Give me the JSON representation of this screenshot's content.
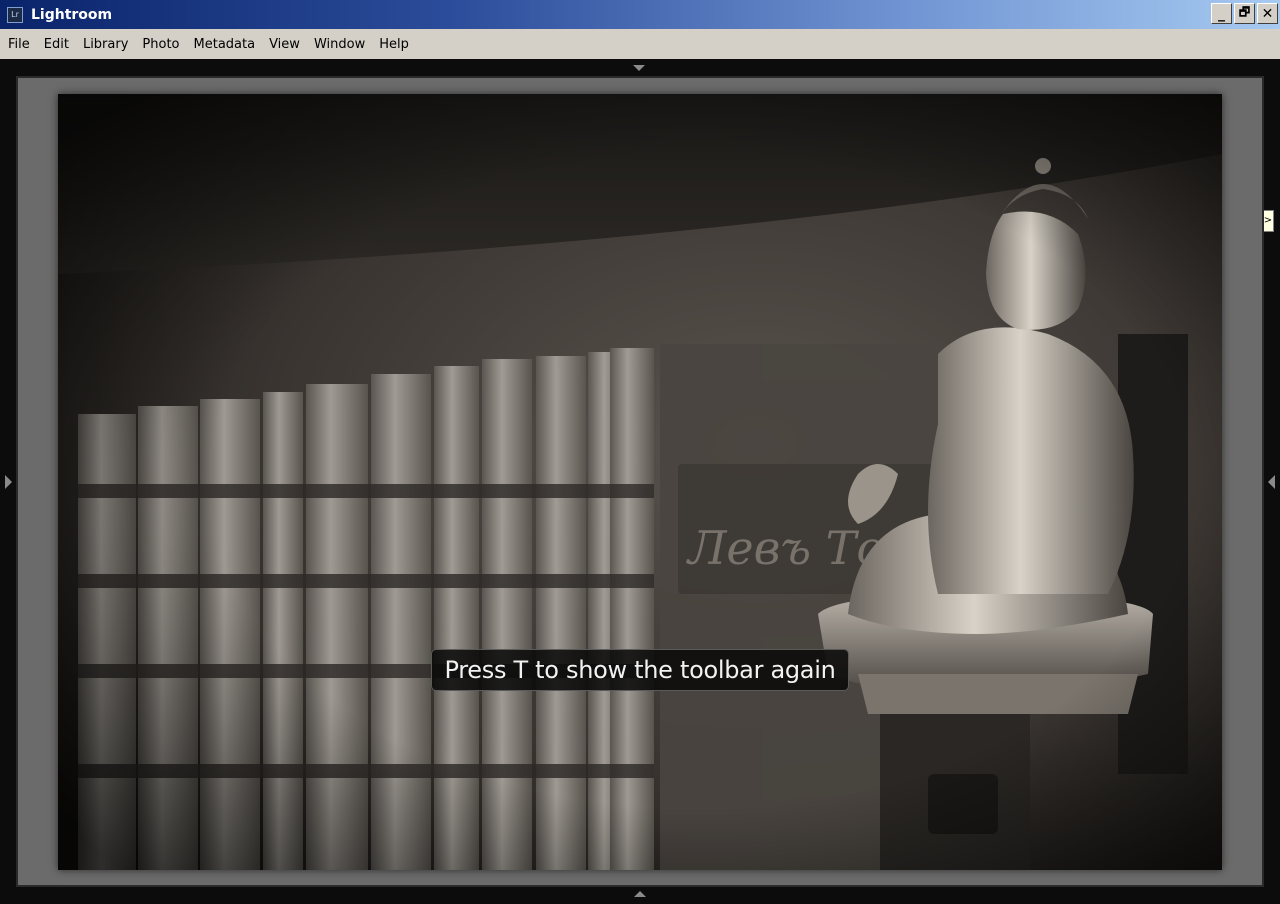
{
  "window": {
    "title": "Lightroom",
    "app_icon_text": "Lr",
    "buttons": {
      "minimize": "_",
      "restore": "🗗",
      "close": "✕"
    }
  },
  "menu": [
    "File",
    "Edit",
    "Library",
    "Photo",
    "Metadata",
    "View",
    "Window",
    "Help"
  ],
  "workspace": {
    "right_panel_tab": ">",
    "toast": "Press T to show the toolbar again",
    "photo": {
      "subject": "Buddha statue beside a row of books",
      "book_spine_text": "Левъ Толст"
    }
  },
  "icons": {
    "app": "lightroom-icon",
    "panel_toggle_top": "triangle-down-icon",
    "panel_toggle_bottom": "triangle-up-icon",
    "panel_toggle_left": "triangle-right-icon",
    "panel_toggle_right": "triangle-left-icon"
  },
  "colors": {
    "titlebar_start": "#0a246a",
    "titlebar_end": "#a6caf0",
    "menubar_bg": "#d4d0c8",
    "frame_bg": "#6b6b6b",
    "workspace_bg": "#0c0c0c"
  }
}
